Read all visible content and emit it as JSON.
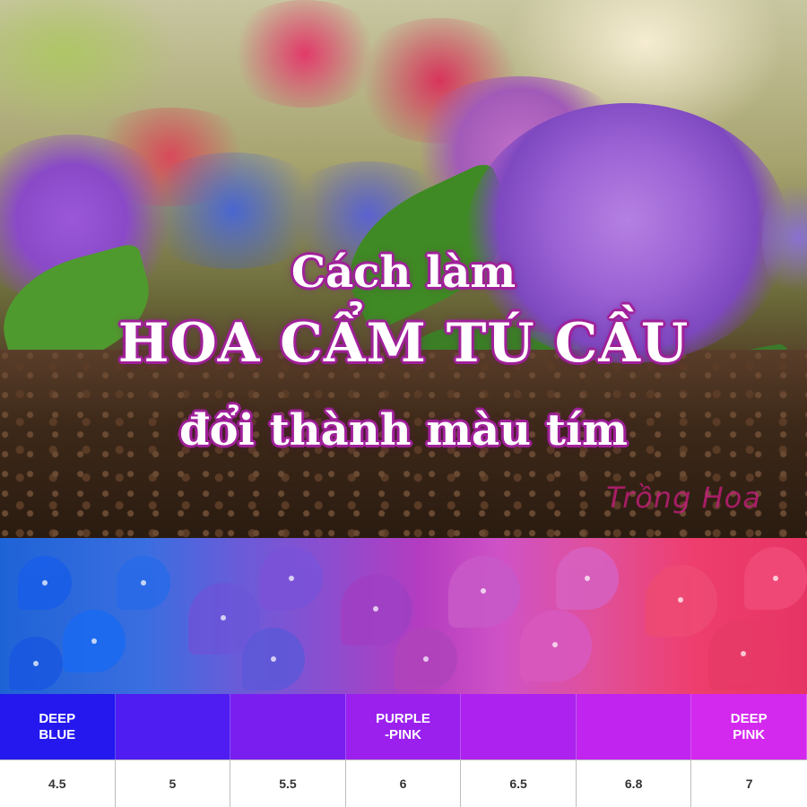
{
  "title": {
    "line1": "Cách làm",
    "line2": "HOA CẨM TÚ CẦU",
    "line3": "đổi thành màu tím"
  },
  "watermark": "Trồng Hoa",
  "colors": {
    "title_text": "#ffffff",
    "title_outline": "#a0209a",
    "watermark": "#cd1e82"
  },
  "ph_scale": {
    "color_row": [
      {
        "label": "DEEP\nBLUE",
        "color": "#2418ef"
      },
      {
        "label": "",
        "color": "#4f1cf2"
      },
      {
        "label": "",
        "color": "#7a1ef0"
      },
      {
        "label": "PURPLE\n-PINK",
        "color": "#9b20ee"
      },
      {
        "label": "",
        "color": "#ad22ee"
      },
      {
        "label": "",
        "color": "#c024ee"
      },
      {
        "label": "DEEP\nPINK",
        "color": "#d328ee"
      }
    ],
    "ph_values": [
      "4.5",
      "5",
      "5.5",
      "6",
      "6.5",
      "6.8",
      "7"
    ]
  }
}
